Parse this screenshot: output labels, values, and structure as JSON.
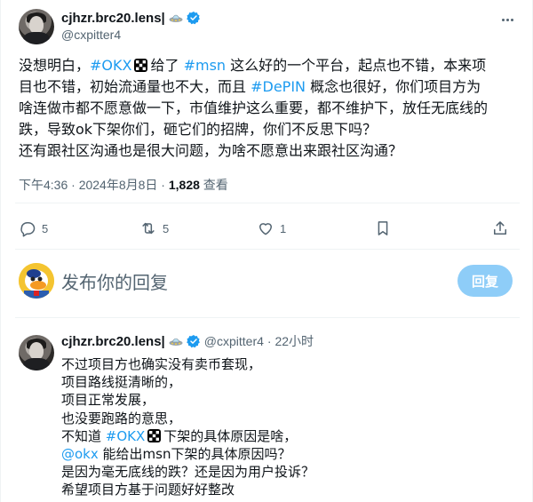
{
  "author": {
    "display_name": "cjhzr.brc20.lens|",
    "handle": "@cxpitter4"
  },
  "post": {
    "line1_pre": "没想明白，",
    "tag_okx": "#OKX",
    "line1_mid": "给了",
    "tag_msn": "#msn",
    "line1_post": "这么好的一个平台，起点也不错，本来项",
    "line2_pre": "目也不错，初始流通量也不大，而且",
    "tag_depin": "#DePIN",
    "line2_post": "概念也很好，你们项目方为",
    "line3": "啥连做市都不愿意做一下，市值维护这么重要，都不维护下，放任无底线的",
    "line4": "跌，导致ok下架你们，砸它们的招牌，你们不反思下吗？",
    "line5": "还有跟社区沟通也是很大问题，为啥不愿意出来跟社区沟通？"
  },
  "meta": {
    "time": "下午4:36 · 2024年8月8日 · ",
    "views": "1,828",
    "views_label": "查看"
  },
  "actions": {
    "replies": "5",
    "reposts": "5",
    "likes": "1"
  },
  "composer": {
    "placeholder": "发布你的回复",
    "button": "回复"
  },
  "reply": {
    "display_name": "cjhzr.brc20.lens|",
    "handle": "@cxpitter4",
    "time": "· 22小时",
    "line1": "不过项目方也确实没有卖币套现，",
    "line2": "项目路线挺清晰的，",
    "line3": "项目正常发展，",
    "line4": "也没要跑路的意思，",
    "line5_pre": "不知道",
    "line5_tag": "#OKX",
    "line5_post": "下架的具体原因是啥，",
    "line6_mention": "@okx",
    "line6_post": "能给出msn下架的具体原因吗？",
    "line7": "是因为毫无底线的跌？还是因为用户投诉？",
    "line8": "希望项目方基于问题好好整改"
  },
  "colors": {
    "link": "#1d9bf0",
    "verified": "#1d9bf0",
    "reply_button": "#8ecdf8"
  }
}
